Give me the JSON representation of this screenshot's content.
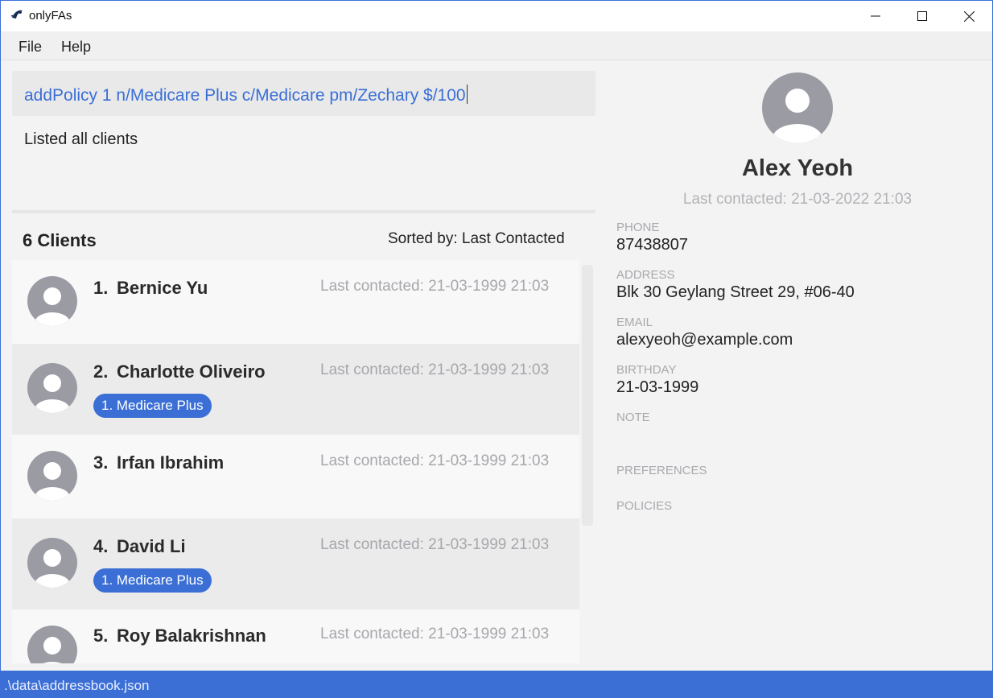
{
  "window": {
    "title": "onlyFAs",
    "minimize_icon": "minimize-icon",
    "maximize_icon": "maximize-icon",
    "close_icon": "close-icon"
  },
  "menu": {
    "file": "File",
    "help": "Help"
  },
  "command": {
    "value": "addPolicy 1 n/Medicare Plus c/Medicare pm/Zechary $/100"
  },
  "result": {
    "message": "Listed all clients"
  },
  "client_list": {
    "count_label": "6 Clients",
    "sort_label": "Sorted by: Last Contacted",
    "clients": [
      {
        "index": "1.",
        "name": "Bernice Yu",
        "last_contacted": "Last contacted: 21-03-1999 21:03",
        "policies": []
      },
      {
        "index": "2.",
        "name": "Charlotte Oliveiro",
        "last_contacted": "Last contacted: 21-03-1999 21:03",
        "policies": [
          "1. Medicare Plus"
        ]
      },
      {
        "index": "3.",
        "name": "Irfan Ibrahim",
        "last_contacted": "Last contacted: 21-03-1999 21:03",
        "policies": []
      },
      {
        "index": "4.",
        "name": "David Li",
        "last_contacted": "Last contacted: 21-03-1999 21:03",
        "policies": [
          "1. Medicare Plus"
        ]
      },
      {
        "index": "5.",
        "name": "Roy Balakrishnan",
        "last_contacted": "Last contacted: 21-03-1999 21:03",
        "policies": []
      }
    ]
  },
  "detail": {
    "name": "Alex Yeoh",
    "last_contacted": "Last contacted: 21-03-2022 21:03",
    "phone_label": "PHONE",
    "phone": "87438807",
    "address_label": "ADDRESS",
    "address": "Blk 30 Geylang Street 29, #06-40",
    "email_label": "EMAIL",
    "email": "alexyeoh@example.com",
    "birthday_label": "BIRTHDAY",
    "birthday": "21-03-1999",
    "note_label": "NOTE",
    "preferences_label": "PREFERENCES",
    "policies_label": "POLICIES"
  },
  "status": {
    "path": ".\\data\\addressbook.json"
  },
  "colors": {
    "accent": "#3b6fd6",
    "avatar": "#9a9ba3",
    "muted_text": "#a7a7ad"
  }
}
